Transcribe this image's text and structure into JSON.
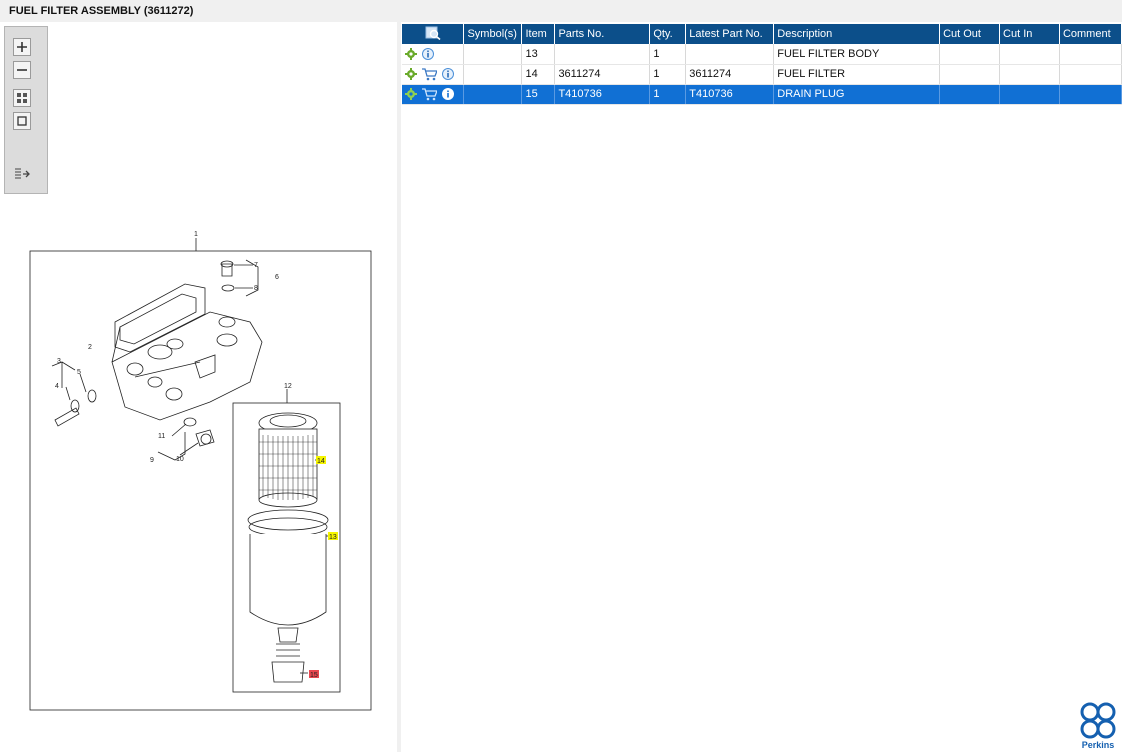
{
  "window": {
    "title": "FUEL FILTER ASSEMBLY (3611272)"
  },
  "toolbar": {
    "buttons": [
      {
        "name": "zoom-in",
        "icon": "plus-icon"
      },
      {
        "name": "zoom-out",
        "icon": "minus-icon"
      },
      {
        "name": "fit-all",
        "icon": "fit-icon"
      },
      {
        "name": "reset-view",
        "icon": "square-icon"
      },
      {
        "name": "export",
        "icon": "export-icon"
      }
    ]
  },
  "drawing": {
    "callouts": {
      "c1": "1",
      "c2": "2",
      "c3": "3",
      "c4": "4",
      "c5": "5",
      "c6": "6",
      "c7": "7",
      "c8": "8",
      "c9": "9",
      "c10": "10",
      "c11": "11",
      "c12": "12",
      "c13": "13",
      "c14": "14",
      "c15": "15"
    },
    "highlight_colors": {
      "yellow": "#f5f500",
      "red": "#e8474f"
    }
  },
  "grid": {
    "columns": {
      "search": "",
      "symbols": "Symbol(s)",
      "item": "Item",
      "parts_no": "Parts No.",
      "qty": "Qty.",
      "latest": "Latest Part No.",
      "description": "Description",
      "cut_out": "Cut Out",
      "cut_in": "Cut In",
      "comment": "Comment"
    },
    "rows": [
      {
        "item": "13",
        "parts_no": "",
        "qty": "1",
        "latest": "",
        "description": "FUEL FILTER BODY",
        "cut_out": "",
        "cut_in": "",
        "comment": "",
        "icons": [
          "gear-icon",
          "info-icon"
        ]
      },
      {
        "item": "14",
        "parts_no": "3611274",
        "qty": "1",
        "latest": "3611274",
        "description": "FUEL FILTER",
        "cut_out": "",
        "cut_in": "",
        "comment": "",
        "icons": [
          "gear-icon",
          "cart-icon",
          "info-icon"
        ]
      },
      {
        "item": "15",
        "parts_no": "T410736",
        "qty": "1",
        "latest": "T410736",
        "description": "DRAIN PLUG",
        "cut_out": "",
        "cut_in": "",
        "comment": "",
        "icons": [
          "gear-icon",
          "cart-icon",
          "info-icon"
        ],
        "selected": true
      }
    ],
    "header_color": "#0c4f8a",
    "selected_color": "#1170d4"
  },
  "brand": {
    "name": "Perkins",
    "color": "#1560b0"
  }
}
